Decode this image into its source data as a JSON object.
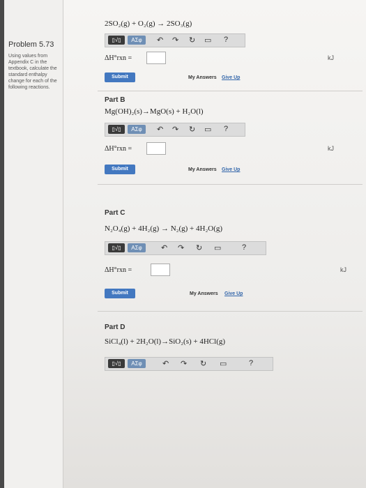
{
  "problem": {
    "title": "Problem 5.73",
    "description": "Using values from Appendix C in the textbook, calculate the standard enthalpy change for each of the following reactions."
  },
  "part_a": {
    "equation": "2SO₂(g) + O₂(g) → 2SO₃(g)",
    "delta_h_label": "ΔH°rxn =",
    "answer_value": "",
    "units_icon": "kJ",
    "submit_label": "Submit",
    "my_answers_label": "My Answers",
    "give_up_label": "Give Up"
  },
  "part_b": {
    "label": "Part B",
    "equation": "Mg(OH)₂(s)→MgO(s) + H₂O(l)",
    "delta_h_label": "ΔH°rxn =",
    "answer_value": "",
    "units_icon": "kJ",
    "submit_label": "Submit",
    "my_answers_label": "My Answers",
    "give_up_label": "Give Up"
  },
  "part_c": {
    "label": "Part C",
    "equation": "N₂O₄(g) + 4H₂(g) → N₂(g) + 4H₂O(g)",
    "delta_h_label": "ΔH°rxn =",
    "answer_value": "",
    "units_icon": "kJ",
    "submit_label": "Submit",
    "my_answers_label": "My Answers",
    "give_up_label": "Give Up"
  },
  "part_d": {
    "label": "Part D",
    "equation": "SiCl₄(l) + 2H₂O(l)→SiO₂(s) + 4HCl(g)"
  },
  "toolbar": {
    "fraction_label": "▯√▯",
    "greek_label": "ΑΣφ",
    "undo_icon": "↶",
    "redo_icon": "↷",
    "reset_icon": "↻",
    "keyboard_icon": "▭",
    "help_icon": "?"
  }
}
